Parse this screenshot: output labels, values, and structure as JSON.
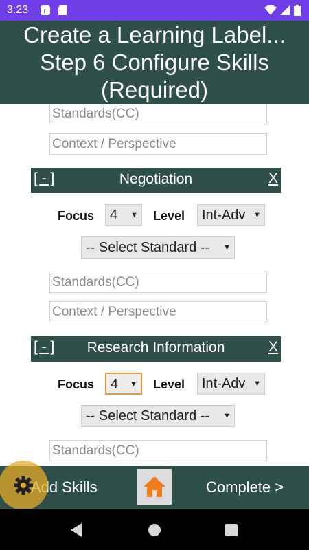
{
  "status_bar": {
    "time": "3:23"
  },
  "header": {
    "title_line1": "Create a Learning Label...",
    "title_line2": "Step 6 Configure Skills",
    "title_line3": "(Required)"
  },
  "top_partial": {
    "standards_placeholder": "Standards(CC)",
    "context_placeholder": "Context / Perspective"
  },
  "skills": [
    {
      "toggle": "[ - ]",
      "name": "Negotiation",
      "close": "X",
      "focus_label": "Focus",
      "focus_value": "4",
      "level_label": "Level",
      "level_value": "Int-Adv",
      "standard_select": "-- Select Standard --",
      "standards_placeholder": "Standards(CC)",
      "context_placeholder": "Context / Perspective"
    },
    {
      "toggle": "[ - ]",
      "name": "Research Information",
      "close": "X",
      "focus_label": "Focus",
      "focus_value": "4",
      "level_label": "Level",
      "level_value": "Int-Adv",
      "standard_select": "-- Select Standard --",
      "standards_placeholder": "Standards(CC)"
    }
  ],
  "bottom_bar": {
    "add_skills": "Add Skills",
    "complete": "Complete >"
  },
  "colors": {
    "header_bg": "#2f4f4a",
    "status_bg": "#6f3ee8",
    "home_icon": "#f07c1e",
    "fab": "#e6aa28"
  },
  "icons": [
    "notification-icon",
    "sd-card-icon",
    "wifi-icon",
    "signal-icon",
    "battery-icon",
    "gear-icon",
    "home-icon",
    "back-icon",
    "home-nav-icon",
    "recents-icon"
  ]
}
